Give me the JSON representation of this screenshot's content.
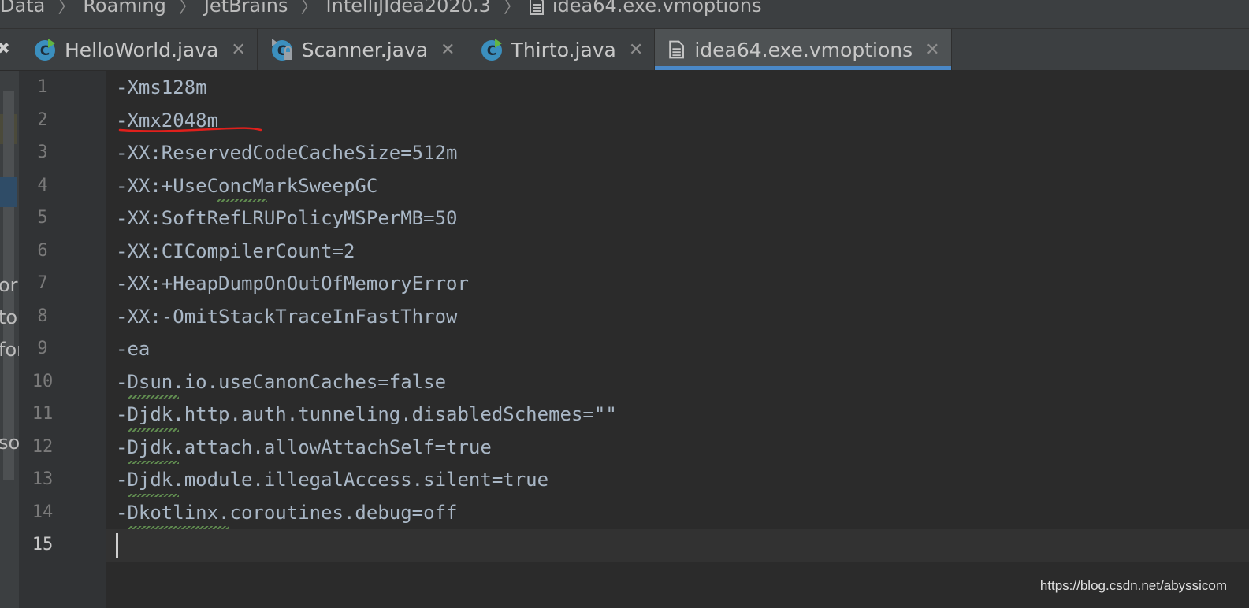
{
  "breadcrumb": {
    "items": [
      "Data",
      "Roaming",
      "JetBrains",
      "IntelliJIdea2020.3"
    ],
    "file": "idea64.exe.vmoptions"
  },
  "tabs": [
    {
      "label": "HelloWorld.java",
      "icon": "java-class-icon",
      "active": false
    },
    {
      "label": "Scanner.java",
      "icon": "java-class-locked-icon",
      "active": false
    },
    {
      "label": "Thirto.java",
      "icon": "java-class-icon",
      "active": false
    },
    {
      "label": "idea64.exe.vmoptions",
      "icon": "text-file-icon",
      "active": true
    }
  ],
  "left_fragments": [
    "or",
    "to",
    "for",
    "so"
  ],
  "editor": {
    "current_line": 15,
    "lines": [
      {
        "num": "1",
        "text": "-Xms128m"
      },
      {
        "num": "2",
        "text": "-Xmx2048m"
      },
      {
        "num": "3",
        "text": "-XX:ReservedCodeCacheSize=512m"
      },
      {
        "num": "4",
        "text": "-XX:+UseConcMarkSweepGC"
      },
      {
        "num": "5",
        "text": "-XX:SoftRefLRUPolicyMSPerMB=50"
      },
      {
        "num": "6",
        "text": "-XX:CICompilerCount=2"
      },
      {
        "num": "7",
        "text": "-XX:+HeapDumpOnOutOfMemoryError"
      },
      {
        "num": "8",
        "text": "-XX:-OmitStackTraceInFastThrow"
      },
      {
        "num": "9",
        "text": "-ea"
      },
      {
        "num": "10",
        "text": "-Dsun.io.useCanonCaches=false"
      },
      {
        "num": "11",
        "text": "-Djdk.http.auth.tunneling.disabledSchemes=\"\""
      },
      {
        "num": "12",
        "text": "-Djdk.attach.allowAttachSelf=true"
      },
      {
        "num": "13",
        "text": "-Djdk.module.illegalAccess.silent=true"
      },
      {
        "num": "14",
        "text": "-Dkotlinx.coroutines.debug=off"
      },
      {
        "num": "15",
        "text": ""
      }
    ]
  },
  "watermark": "https://blog.csdn.net/abyssicom",
  "colors": {
    "background": "#2b2b2b",
    "code_text": "#a9b7c6",
    "active_tab_underline": "#4a88c7",
    "typo_squiggle": "#5f8a4f",
    "annotation": "#e0201c"
  }
}
